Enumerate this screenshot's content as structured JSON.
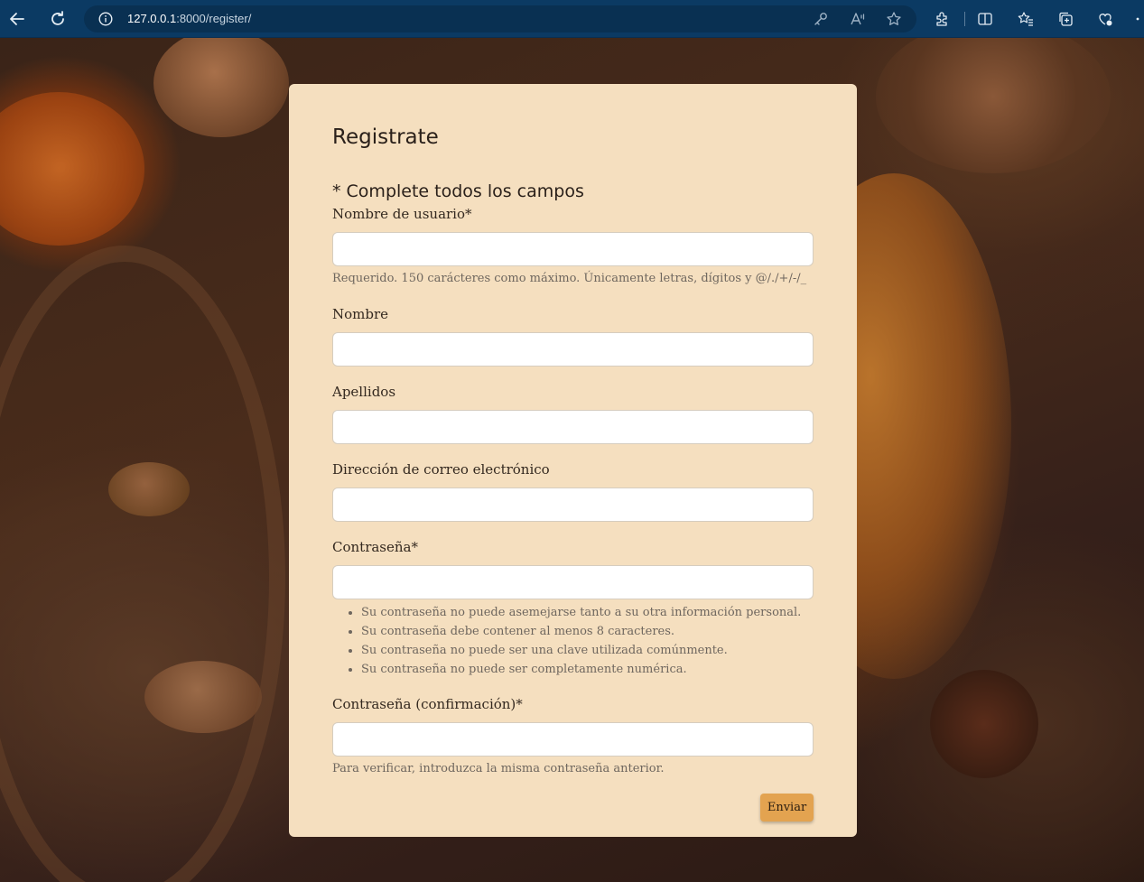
{
  "browser": {
    "url_host": "127.0.0.1",
    "url_rest": ":8000/register/",
    "icons": [
      "back-icon",
      "refresh-icon",
      "site-info-icon",
      "key-icon",
      "read-aloud-icon",
      "favorite-star-icon",
      "extensions-icon",
      "split-screen-icon",
      "favorites-icon",
      "collections-icon",
      "copilot-icon"
    ]
  },
  "form": {
    "title": "Registrate",
    "subtitle": "* Complete todos los campos",
    "fields": {
      "username": {
        "label": "Nombre de usuario*",
        "value": "",
        "help": "Requerido. 150 carácteres como máximo. Únicamente letras, dígitos y @/./+/-/_"
      },
      "first_name": {
        "label": "Nombre",
        "value": ""
      },
      "last_name": {
        "label": "Apellidos",
        "value": ""
      },
      "email": {
        "label": "Dirección de correo electrónico",
        "value": ""
      },
      "password1": {
        "label": "Contraseña*",
        "value": "",
        "rules": [
          "Su contraseña no puede asemejarse tanto a su otra información personal.",
          "Su contraseña debe contener al menos 8 caracteres.",
          "Su contraseña no puede ser una clave utilizada comúnmente.",
          "Su contraseña no puede ser completamente numérica."
        ]
      },
      "password2": {
        "label": "Contraseña (confirmación)*",
        "value": "",
        "help": "Para verificar, introduzca la misma contraseña anterior."
      }
    },
    "submit_label": "Enviar"
  },
  "colors": {
    "browser_bar": "#0b3a63",
    "card_background": "#f5dfbf",
    "button": "#e3a350"
  }
}
